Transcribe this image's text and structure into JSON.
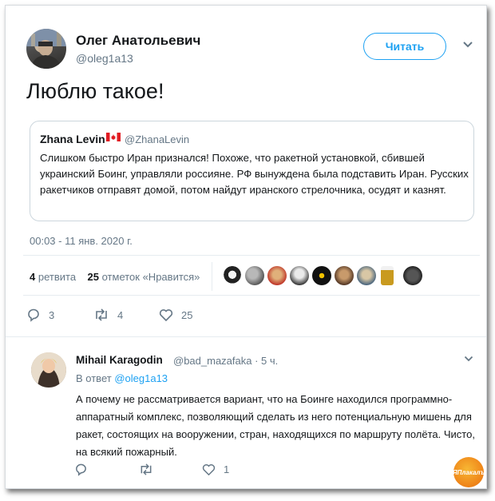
{
  "tweet": {
    "author_name": "Олег Анатольевич",
    "author_handle": "@oleg1a13",
    "follow_label": "Читать",
    "text": "Люблю такое!",
    "timestamp": "00:03 - 11 янв. 2020 г."
  },
  "quoted": {
    "author_name": "Zhana Levin",
    "author_handle": "@ZhanaLevin",
    "text": "Слишком быстро Иран признался! Похоже, что ракетной установкой, сбившей украинский Боинг, управляли россияне. РФ вынуждена была подставить Иран. Русских ракетчиков отправят домой, потом найдут иранского стрелочника, осудят и казнят."
  },
  "stats": {
    "retweets_count": "4",
    "retweets_label": "ретвита",
    "likes_count": "25",
    "likes_label": "отметок «Нравится»"
  },
  "actions": {
    "reply_count": "3",
    "retweet_count": "4",
    "like_count": "25"
  },
  "reply": {
    "author_name": "Mihail Karagodin",
    "author_handle": "@bad_mazafaka · 5 ч.",
    "in_reply_prefix": "В ответ",
    "in_reply_handle": "@oleg1a13",
    "text": "А почему не рассматривается вариант, что на Боинге находился программно-аппаратный комплекс, позволяющий сделать из него потенциальную мишень для ракет, состоящих на вооружении, стран, находящихся по маршруту полёта. Чисто, на всякий пожарный.",
    "like_count": "1"
  },
  "watermark": {
    "text": "ЯПлакалъ"
  },
  "colors": {
    "accent": "#1da1f2",
    "muted": "#657786",
    "text": "#14171a",
    "border": "#e6ecf0"
  }
}
